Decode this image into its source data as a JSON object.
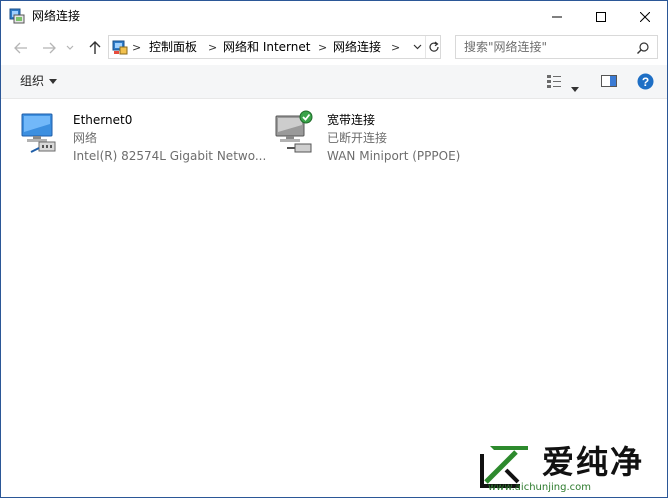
{
  "window": {
    "title": "网络连接"
  },
  "navigation": {
    "back": "back-arrow-icon",
    "forward": "forward-arrow-icon",
    "recent": "chevron-down-icon",
    "up": "up-arrow-icon"
  },
  "address": {
    "breadcrumbs": [
      "控制面板",
      "网络和 Internet",
      "网络连接"
    ],
    "separator": ">"
  },
  "search": {
    "placeholder": "搜索\"网络连接\""
  },
  "commandbar": {
    "organize_label": "组织"
  },
  "connections": [
    {
      "name": "Ethernet0",
      "status": "网络",
      "device": "Intel(R) 82574L Gigabit Netwo..."
    },
    {
      "name": "宽带连接",
      "status": "已断开连接",
      "device": "WAN Miniport (PPPOE)"
    }
  ],
  "watermark": {
    "text": "爱纯净",
    "url": "www.aichunjing.com"
  },
  "colors": {
    "accent": "#0078d7",
    "help": "#1e6fc5",
    "status_text": "#6d6d6d",
    "watermark_green": "#2c7a2c"
  }
}
